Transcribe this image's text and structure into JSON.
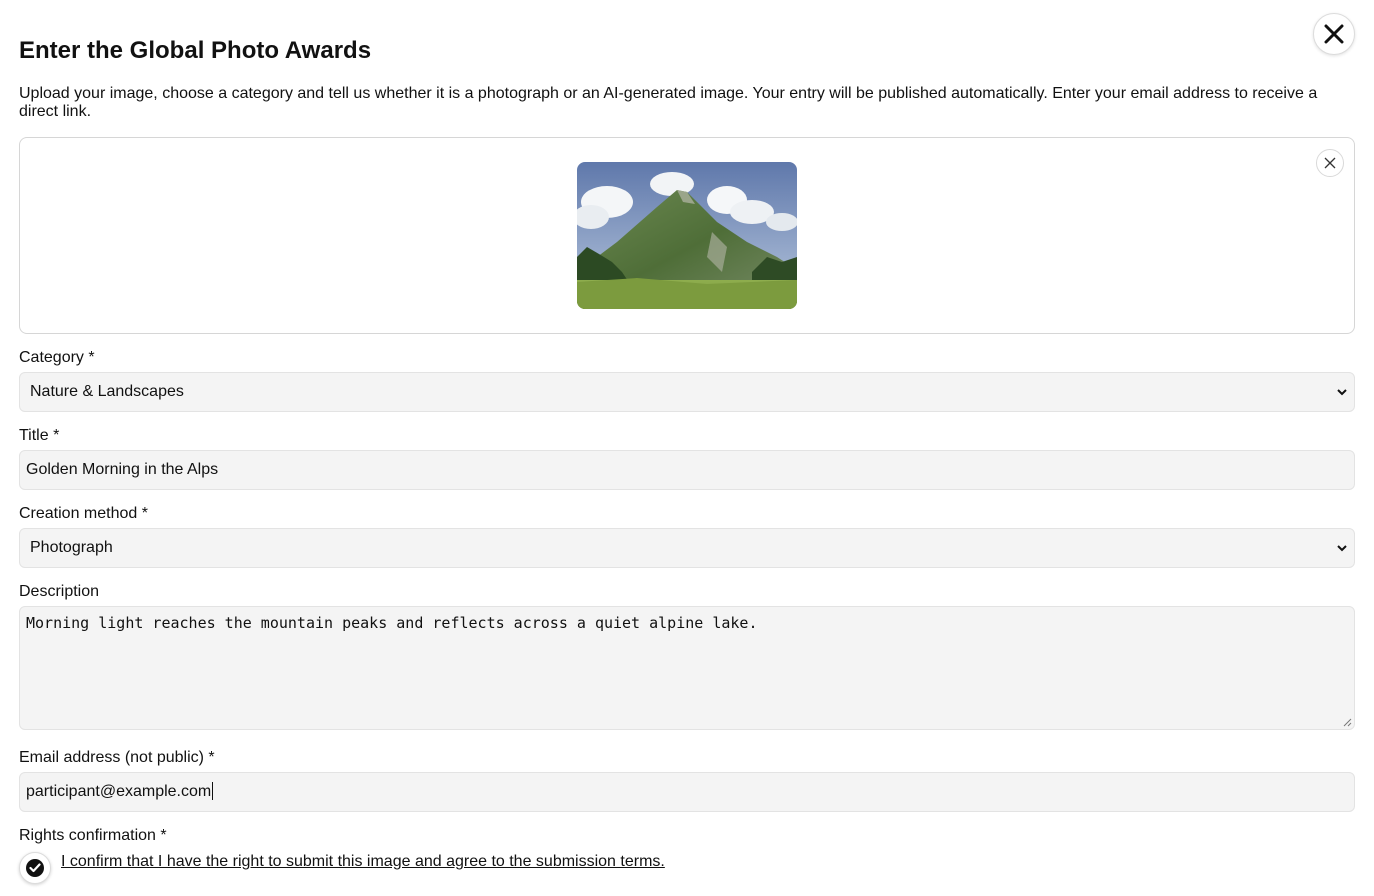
{
  "form": {
    "title": "Enter the Global Photo Awards",
    "intro": "Upload your image, choose a category and tell us whether it is a photograph or an AI-generated image. Your entry will be published automatically. Enter your email address to receive a direct link."
  },
  "icons": {
    "close": "close-icon",
    "remove_image": "x-icon",
    "dropdown": "chevron-down-icon",
    "resize": "resize-grip-icon",
    "check": "checkmark-icon"
  },
  "upload": {
    "preview_alt": "Uploaded mountain landscape preview"
  },
  "category": {
    "label": "Category *",
    "selected": "Nature & Landscapes"
  },
  "title_field": {
    "label": "Title *",
    "value": "Golden Morning in the Alps"
  },
  "creation_method": {
    "label": "Creation method *",
    "selected": "Photograph"
  },
  "description": {
    "label": "Description",
    "value": "Morning light reaches the mountain peaks and reflects across a quiet alpine lake."
  },
  "email": {
    "label": "Email address (not public) *",
    "value": "participant@example.com"
  },
  "rights": {
    "label": "Rights confirmation *",
    "checked": true,
    "text": "I confirm that I have the right to submit this image and agree to the submission terms."
  },
  "colors": {
    "text": "#111111",
    "field_bg": "#f4f4f4",
    "border": "#d6d6d6"
  }
}
